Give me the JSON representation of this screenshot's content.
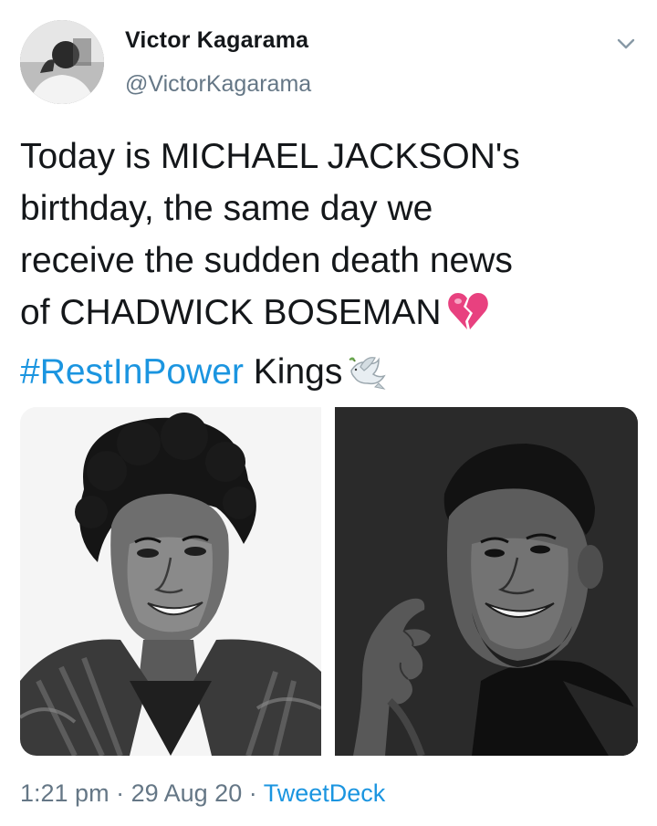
{
  "author": {
    "display_name": "Victor Kagarama",
    "handle": "@VictorKagarama"
  },
  "tweet": {
    "lines": [
      "Today is MICHAEL JACKSON's",
      "birthday, the same day we",
      "receive the sudden death news",
      "of CHADWICK BOSEMAN"
    ],
    "hashtag": "#RestInPower",
    "after_hashtag": "Kings",
    "emojis": [
      "broken-heart-icon",
      "dove-icon"
    ]
  },
  "media": {
    "count": 2
  },
  "meta": {
    "time": "1:21 pm",
    "separator": "·",
    "date": "29 Aug 20",
    "source": "TweetDeck"
  },
  "colors": {
    "link": "#1b95e0",
    "secondary_text": "#657786",
    "primary_text": "#14171a",
    "broken_heart": "#e8417f"
  }
}
